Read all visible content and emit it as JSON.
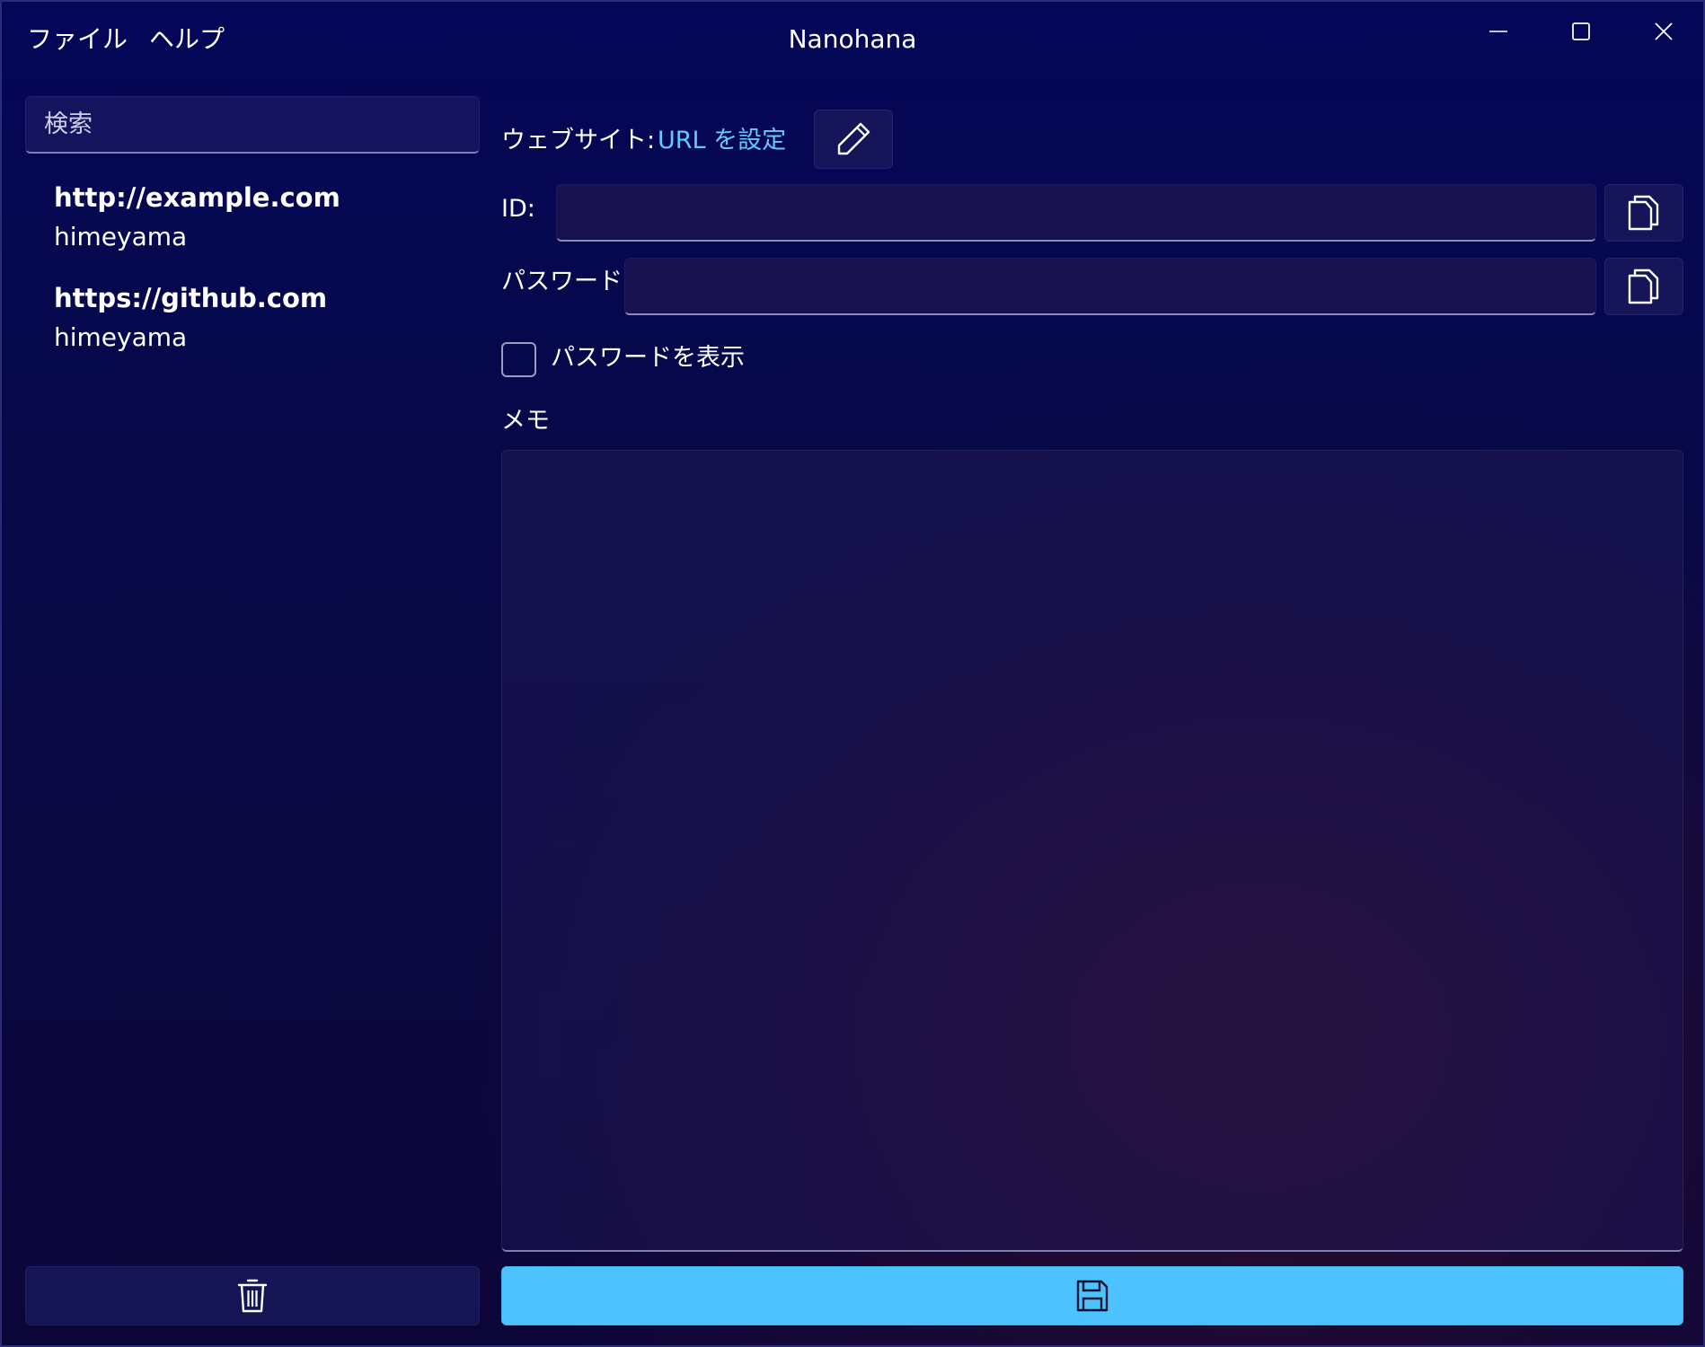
{
  "colors": {
    "accent": "#4cc2ff",
    "link": "#64c8ff",
    "background": "#06062e"
  },
  "window": {
    "title": "Nanohana",
    "controls": [
      "minimize-icon",
      "maximize-icon",
      "close-icon"
    ]
  },
  "menu": {
    "file": "ファイル",
    "help": "ヘルプ"
  },
  "sidebar": {
    "search_placeholder": "検索",
    "items": [
      {
        "url": "http://example.com",
        "user": "himeyama"
      },
      {
        "url": "https://github.com",
        "user": "himeyama"
      }
    ],
    "delete_icon": "trash-icon"
  },
  "detail": {
    "website_label": "ウェブサイト:",
    "website_link": "URL を設定",
    "edit_icon": "pencil-icon",
    "id_label": "ID:",
    "id_value": "",
    "password_label": "パスワード:",
    "password_value": "",
    "copy_icon": "copy-icon",
    "show_password_label": "パスワードを表示",
    "show_password_checked": false,
    "memo_label": "メモ",
    "memo_value": "",
    "save_icon": "save-icon"
  }
}
